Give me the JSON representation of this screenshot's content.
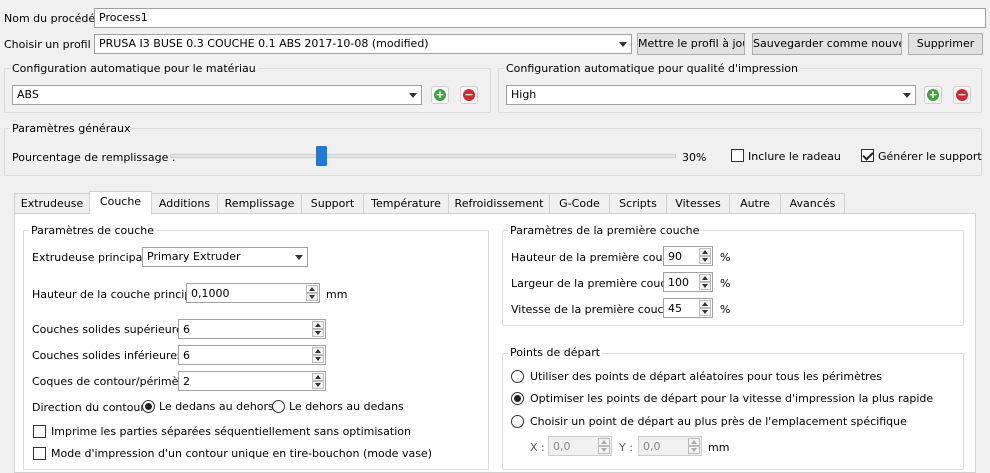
{
  "process": {
    "label": "Nom du procédé :",
    "value": "Process1"
  },
  "profile": {
    "label": "Choisir un profil :",
    "selected": "PRUSA I3 BUSE 0.3 COUCHE 0.1 ABS 2017-10-08 (modified)",
    "update_label": "Mettre le profil à jour",
    "save_new_label": "Sauvegarder comme nouveau",
    "delete_label": "Supprimer"
  },
  "material": {
    "title": "Configuration automatique pour le matériau",
    "selected": "ABS"
  },
  "quality": {
    "title": "Configuration automatique pour qualité d'impression",
    "selected": "High"
  },
  "general": {
    "title": "Paramètres généraux",
    "infill_label": "Pourcentage de remplissage :",
    "infill_value": "30%",
    "infill_fraction": 0.3,
    "raft_label": "Inclure le radeau",
    "raft_checked": false,
    "support_label": "Générer le support",
    "support_checked": true
  },
  "tabs": [
    {
      "label": "Extrudeuse"
    },
    {
      "label": "Couche",
      "active": true
    },
    {
      "label": "Additions"
    },
    {
      "label": "Remplissage"
    },
    {
      "label": "Support"
    },
    {
      "label": "Température"
    },
    {
      "label": "Refroidissement"
    },
    {
      "label": "G-Code"
    },
    {
      "label": "Scripts"
    },
    {
      "label": "Vitesses"
    },
    {
      "label": "Autre"
    },
    {
      "label": "Avancés"
    }
  ],
  "layer": {
    "title": "Paramètres de couche",
    "extruder_label": "Extrudeuse principale",
    "extruder_value": "Primary Extruder",
    "height_label": "Hauteur de la couche principale",
    "height_value": "0,1000",
    "height_unit": "mm",
    "top_label": "Couches solides supérieures",
    "top_value": "6",
    "bottom_label": "Couches solides inférieures",
    "bottom_value": "6",
    "perim_label": "Coques de contour/périmètre",
    "perim_value": "2",
    "direction_label": "Direction du contour :",
    "dir_inside_out": "Le dedans au dehors",
    "dir_outside_in": "Le dehors au dedans",
    "sequential_label": "Imprime les parties séparées séquentiellement sans optimisation",
    "vase_label": "Mode d'impression d'un contour unique en tire-bouchon (mode vase)"
  },
  "first_layer": {
    "title": "Paramètres de la première couche",
    "height_label": "Hauteur de la première couche",
    "height_value": "90",
    "width_label": "Largeur de la première couche",
    "width_value": "100",
    "speed_label": "Vitesse de la première couche",
    "speed_value": "45",
    "unit": "%"
  },
  "start_points": {
    "title": "Points de départ",
    "random_label": "Utiliser des points de départ aléatoires pour tous les périmètres",
    "optimize_label": "Optimiser les points de départ pour la vitesse d'impression la plus rapide",
    "closest_label": "Choisir un point de départ au plus près de l'emplacement spécifique",
    "x_label": "X :",
    "x_value": "0,0",
    "y_label": "Y :",
    "y_value": "0,0",
    "unit": "mm"
  },
  "colors": {
    "add": "#3ea33e",
    "remove": "#d9232d",
    "slider": "#1e7bd9"
  }
}
